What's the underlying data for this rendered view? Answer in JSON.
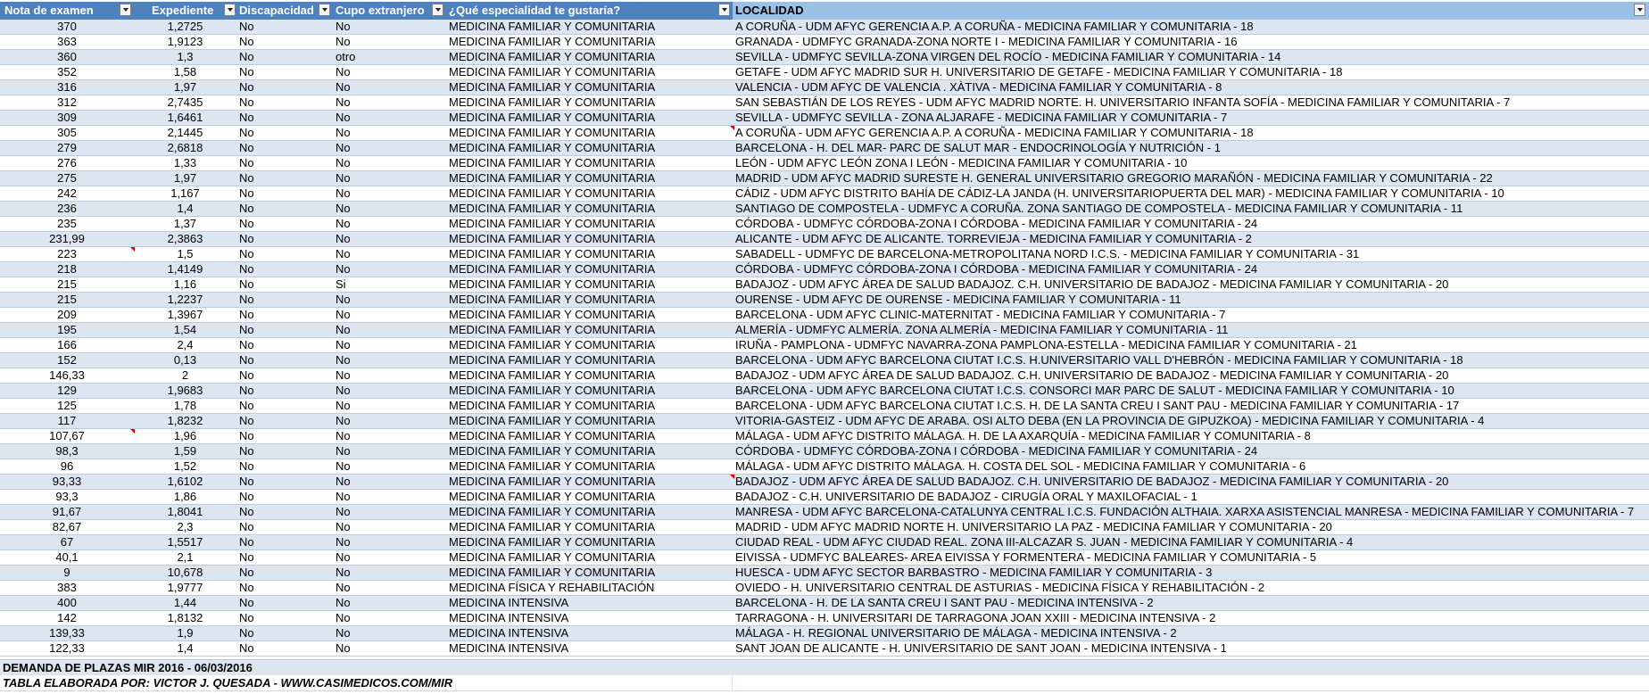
{
  "sheet": {
    "headers": [
      "Nota de examen",
      "Expediente",
      "Discapacidad",
      "Cupo extranjero",
      "¿Qué especialidad te gustaría?",
      "LOCALIDAD"
    ],
    "rows": [
      [
        "370",
        "1,2725",
        "No",
        "No",
        "MEDICINA FAMILIAR Y COMUNITARIA",
        "A CORUÑA - UDM AFYC GERENCIA A.P. A CORUÑA - MEDICINA FAMILIAR Y COMUNITARIA - 18"
      ],
      [
        "363",
        "1,9123",
        "No",
        "No",
        "MEDICINA FAMILIAR Y COMUNITARIA",
        "GRANADA - UDMFYC GRANADA-ZONA NORTE I - MEDICINA FAMILIAR Y COMUNITARIA - 16"
      ],
      [
        "360",
        "1,3",
        "No",
        "otro",
        "MEDICINA FAMILIAR Y COMUNITARIA",
        "SEVILLA - UDMFYC SEVILLA-ZONA VIRGEN DEL ROCÍO - MEDICINA FAMILIAR Y COMUNITARIA - 14"
      ],
      [
        "352",
        "1,58",
        "No",
        "No",
        "MEDICINA FAMILIAR Y COMUNITARIA",
        "GETAFE - UDM AFYC MADRID SUR H. UNIVERSITARIO DE GETAFE - MEDICINA FAMILIAR Y COMUNITARIA - 18"
      ],
      [
        "316",
        "1,97",
        "No",
        "No",
        "MEDICINA FAMILIAR Y COMUNITARIA",
        "VALENCIA - UDM AFYC DE VALENCIA . XÀTIVA - MEDICINA FAMILIAR Y COMUNITARIA - 8"
      ],
      [
        "312",
        "2,7435",
        "No",
        "No",
        "MEDICINA FAMILIAR Y COMUNITARIA",
        "SAN SEBASTIÁN DE LOS REYES - UDM AFYC MADRID NORTE. H. UNIVERSITARIO INFANTA SOFÍA - MEDICINA FAMILIAR Y COMUNITARIA - 7"
      ],
      [
        "309",
        "1,6461",
        "No",
        "No",
        "MEDICINA FAMILIAR Y COMUNITARIA",
        "SEVILLA - UDMFYC SEVILLA - ZONA ALJARAFE - MEDICINA FAMILIAR Y COMUNITARIA - 7"
      ],
      [
        "305",
        "2,1445",
        "No",
        "No",
        "MEDICINA FAMILIAR Y COMUNITARIA",
        "A CORUÑA - UDM AFYC GERENCIA A.P. A CORUÑA - MEDICINA FAMILIAR Y COMUNITARIA - 18"
      ],
      [
        "279",
        "2,6818",
        "No",
        "No",
        "MEDICINA FAMILIAR Y COMUNITARIA",
        "BARCELONA - H. DEL MAR- PARC DE SALUT MAR - ENDOCRINOLOGÍA Y NUTRICIÓN - 1"
      ],
      [
        "276",
        "1,33",
        "No",
        "No",
        "MEDICINA FAMILIAR Y COMUNITARIA",
        "LEÓN - UDM AFYC LEÓN ZONA I LEÓN - MEDICINA FAMILIAR Y COMUNITARIA - 10"
      ],
      [
        "275",
        "1,97",
        "No",
        "No",
        "MEDICINA FAMILIAR Y COMUNITARIA",
        "MADRID - UDM AFYC MADRID SURESTE H. GENERAL UNIVERSITARIO GREGORIO MARAÑÓN - MEDICINA FAMILIAR Y COMUNITARIA - 22"
      ],
      [
        "242",
        "1,167",
        "No",
        "No",
        "MEDICINA FAMILIAR Y COMUNITARIA",
        "CÁDIZ - UDM AFYC DISTRITO BAHÍA DE CÁDIZ-LA JANDA (H. UNIVERSITARIOPUERTA DEL MAR) - MEDICINA FAMILIAR Y COMUNITARIA - 10"
      ],
      [
        "236",
        "1,4",
        "No",
        "No",
        "MEDICINA FAMILIAR Y COMUNITARIA",
        "SANTIAGO DE COMPOSTELA - UDMFYC A CORUÑA. ZONA SANTIAGO DE COMPOSTELA - MEDICINA FAMILIAR Y COMUNITARIA - 11"
      ],
      [
        "235",
        "1,37",
        "No",
        "No",
        "MEDICINA FAMILIAR Y COMUNITARIA",
        "CÓRDOBA - UDMFYC CÓRDOBA-ZONA I CÓRDOBA - MEDICINA FAMILIAR Y COMUNITARIA - 24"
      ],
      [
        "231,99",
        "2,3863",
        "No",
        "No",
        "MEDICINA FAMILIAR Y COMUNITARIA",
        "ALICANTE - UDM AFYC DE ALICANTE. TORREVIEJA - MEDICINA FAMILIAR Y COMUNITARIA - 2"
      ],
      [
        "223",
        "1,5",
        "No",
        "No",
        "MEDICINA FAMILIAR Y COMUNITARIA",
        "SABADELL - UDMFYC DE BARCELONA-METROPOLITANA NORD I.C.S. - MEDICINA FAMILIAR Y COMUNITARIA - 31"
      ],
      [
        "218",
        "1,4149",
        "No",
        "No",
        "MEDICINA FAMILIAR Y COMUNITARIA",
        "CÓRDOBA - UDMFYC CÓRDOBA-ZONA I CÓRDOBA - MEDICINA FAMILIAR Y COMUNITARIA - 24"
      ],
      [
        "215",
        "1,16",
        "No",
        "Si",
        "MEDICINA FAMILIAR Y COMUNITARIA",
        "BADAJOZ - UDM AFYC ÁREA DE SALUD BADAJOZ. C.H. UNIVERSITARIO DE BADAJOZ - MEDICINA FAMILIAR Y COMUNITARIA - 20"
      ],
      [
        "215",
        "1,2237",
        "No",
        "No",
        "MEDICINA FAMILIAR Y COMUNITARIA",
        "OURENSE - UDM AFYC DE OURENSE - MEDICINA FAMILIAR Y COMUNITARIA - 11"
      ],
      [
        "209",
        "1,3967",
        "No",
        "No",
        "MEDICINA FAMILIAR Y COMUNITARIA",
        "BARCELONA - UDM AFYC CLINIC-MATERNITAT - MEDICINA FAMILIAR Y COMUNITARIA - 7"
      ],
      [
        "195",
        "1,54",
        "No",
        "No",
        "MEDICINA FAMILIAR Y COMUNITARIA",
        "ALMERÍA - UDMFYC ALMERÍA. ZONA ALMERÍA - MEDICINA FAMILIAR Y COMUNITARIA - 11"
      ],
      [
        "166",
        "2,4",
        "No",
        "No",
        "MEDICINA FAMILIAR Y COMUNITARIA",
        "IRUÑA - PAMPLONA - UDMFYC NAVARRA-ZONA PAMPLONA-ESTELLA - MEDICINA FAMILIAR Y COMUNITARIA - 21"
      ],
      [
        "152",
        "0,13",
        "No",
        "No",
        "MEDICINA FAMILIAR Y COMUNITARIA",
        "BARCELONA - UDM AFYC BARCELONA CIUTAT I.C.S. H.UNIVERSITARIO VALL D'HEBRÓN - MEDICINA FAMILIAR Y COMUNITARIA - 18"
      ],
      [
        "146,33",
        "2",
        "No",
        "No",
        "MEDICINA FAMILIAR Y COMUNITARIA",
        "BADAJOZ - UDM AFYC ÁREA DE SALUD BADAJOZ. C.H. UNIVERSITARIO DE BADAJOZ - MEDICINA FAMILIAR Y COMUNITARIA - 20"
      ],
      [
        "129",
        "1,9683",
        "No",
        "No",
        "MEDICINA FAMILIAR Y COMUNITARIA",
        "BARCELONA - UDM AFYC BARCELONA CIUTAT I.C.S. CONSORCI MAR PARC DE SALUT - MEDICINA FAMILIAR Y COMUNITARIA - 10"
      ],
      [
        "125",
        "1,78",
        "No",
        "No",
        "MEDICINA FAMILIAR Y COMUNITARIA",
        "BARCELONA - UDM AFYC BARCELONA CIUTAT I.C.S. H. DE LA SANTA CREU I SANT PAU - MEDICINA FAMILIAR Y COMUNITARIA - 17"
      ],
      [
        "117",
        "1,8232",
        "No",
        "No",
        "MEDICINA FAMILIAR Y COMUNITARIA",
        "VITORIA-GASTEIZ - UDM AFYC DE ARABA. OSI ALTO DEBA (EN LA PROVINCIA DE GIPUZKOA) - MEDICINA FAMILIAR Y COMUNITARIA - 4"
      ],
      [
        "107,67",
        "1,96",
        "No",
        "No",
        "MEDICINA FAMILIAR Y COMUNITARIA",
        "MÁLAGA - UDM AFYC DISTRITO MÁLAGA. H. DE LA AXARQUÍA - MEDICINA FAMILIAR Y COMUNITARIA - 8"
      ],
      [
        "98,3",
        "1,59",
        "No",
        "No",
        "MEDICINA FAMILIAR Y COMUNITARIA",
        "CÓRDOBA - UDMFYC CÓRDOBA-ZONA I CÓRDOBA - MEDICINA FAMILIAR Y COMUNITARIA - 24"
      ],
      [
        "96",
        "1,52",
        "No",
        "No",
        "MEDICINA FAMILIAR Y COMUNITARIA",
        "MÁLAGA - UDM AFYC DISTRITO MÁLAGA. H. COSTA DEL SOL - MEDICINA FAMILIAR Y COMUNITARIA - 6"
      ],
      [
        "93,33",
        "1,6102",
        "No",
        "No",
        "MEDICINA FAMILIAR Y COMUNITARIA",
        "BADAJOZ - UDM AFYC ÁREA DE SALUD BADAJOZ. C.H. UNIVERSITARIO DE BADAJOZ - MEDICINA FAMILIAR Y COMUNITARIA - 20"
      ],
      [
        "93,3",
        "1,86",
        "No",
        "No",
        "MEDICINA FAMILIAR Y COMUNITARIA",
        "BADAJOZ - C.H. UNIVERSITARIO DE BADAJOZ - CIRUGÍA ORAL Y MAXILOFACIAL - 1"
      ],
      [
        "91,67",
        "1,8041",
        "No",
        "No",
        "MEDICINA FAMILIAR Y COMUNITARIA",
        "MANRESA - UDM AFYC BARCELONA-CATALUNYA CENTRAL I.C.S. FUNDACIÓN ALTHAIA. XARXA ASISTENCIAL MANRESA - MEDICINA FAMILIAR Y COMUNITARIA - 7"
      ],
      [
        "82,67",
        "2,3",
        "No",
        "No",
        "MEDICINA FAMILIAR Y COMUNITARIA",
        "MADRID - UDM AFYC MADRID NORTE H. UNIVERSITARIO LA PAZ - MEDICINA FAMILIAR Y COMUNITARIA - 20"
      ],
      [
        "67",
        "1,5517",
        "No",
        "No",
        "MEDICINA FAMILIAR Y COMUNITARIA",
        "CIUDAD REAL - UDM AFYC CIUDAD REAL. ZONA III-ALCAZAR S. JUAN - MEDICINA FAMILIAR Y COMUNITARIA - 4"
      ],
      [
        "40,1",
        "2,1",
        "No",
        "No",
        "MEDICINA FAMILIAR Y COMUNITARIA",
        "EIVISSA - UDMFYC BALEARES- AREA EIVISSA Y FORMENTERA - MEDICINA FAMILIAR Y COMUNITARIA - 5"
      ],
      [
        "9",
        "10,678",
        "No",
        "No",
        "MEDICINA FAMILIAR Y COMUNITARIA",
        "HUESCA - UDM AFYC SECTOR BARBASTRO - MEDICINA FAMILIAR Y COMUNITARIA - 3"
      ],
      [
        "383",
        "1,9777",
        "No",
        "No",
        "MEDICINA FÍSICA Y REHABILITACIÓN",
        "OVIEDO - H. UNIVERSITARIO CENTRAL DE ASTURIAS - MEDICINA FÍSICA Y REHABILITACIÓN - 2"
      ],
      [
        "400",
        "1,44",
        "No",
        "No",
        "MEDICINA INTENSIVA",
        "BARCELONA - H. DE LA SANTA CREU I SANT PAU - MEDICINA INTENSIVA - 2"
      ],
      [
        "142",
        "1,8132",
        "No",
        "No",
        "MEDICINA INTENSIVA",
        "TARRAGONA - H. UNIVERSITARI DE TARRAGONA JOAN XXIII - MEDICINA INTENSIVA - 2"
      ],
      [
        "139,33",
        "1,9",
        "No",
        "No",
        "MEDICINA INTENSIVA",
        "MÁLAGA - H. REGIONAL UNIVERSITARIO DE MÁLAGA - MEDICINA INTENSIVA - 2"
      ],
      [
        "122,33",
        "1,4",
        "No",
        "No",
        "MEDICINA INTENSIVA",
        "SANT JOAN DE ALICANTE - H. UNIVERSITARIO DE SANT JOAN - MEDICINA INTENSIVA - 1"
      ]
    ],
    "footer_title": "DEMANDA DE PLAZAS MIR 2016 - 06/03/2016",
    "footer_credit": "TABLA ELABORADA POR: VICTOR J. QUESADA - WWW.CASIMEDICOS.COM/MIR",
    "colors": {
      "header_bg": "#4f81bd",
      "header_text": "#ffffff",
      "band_row": "#dce6f1",
      "comment_marker": "#e00000"
    }
  }
}
